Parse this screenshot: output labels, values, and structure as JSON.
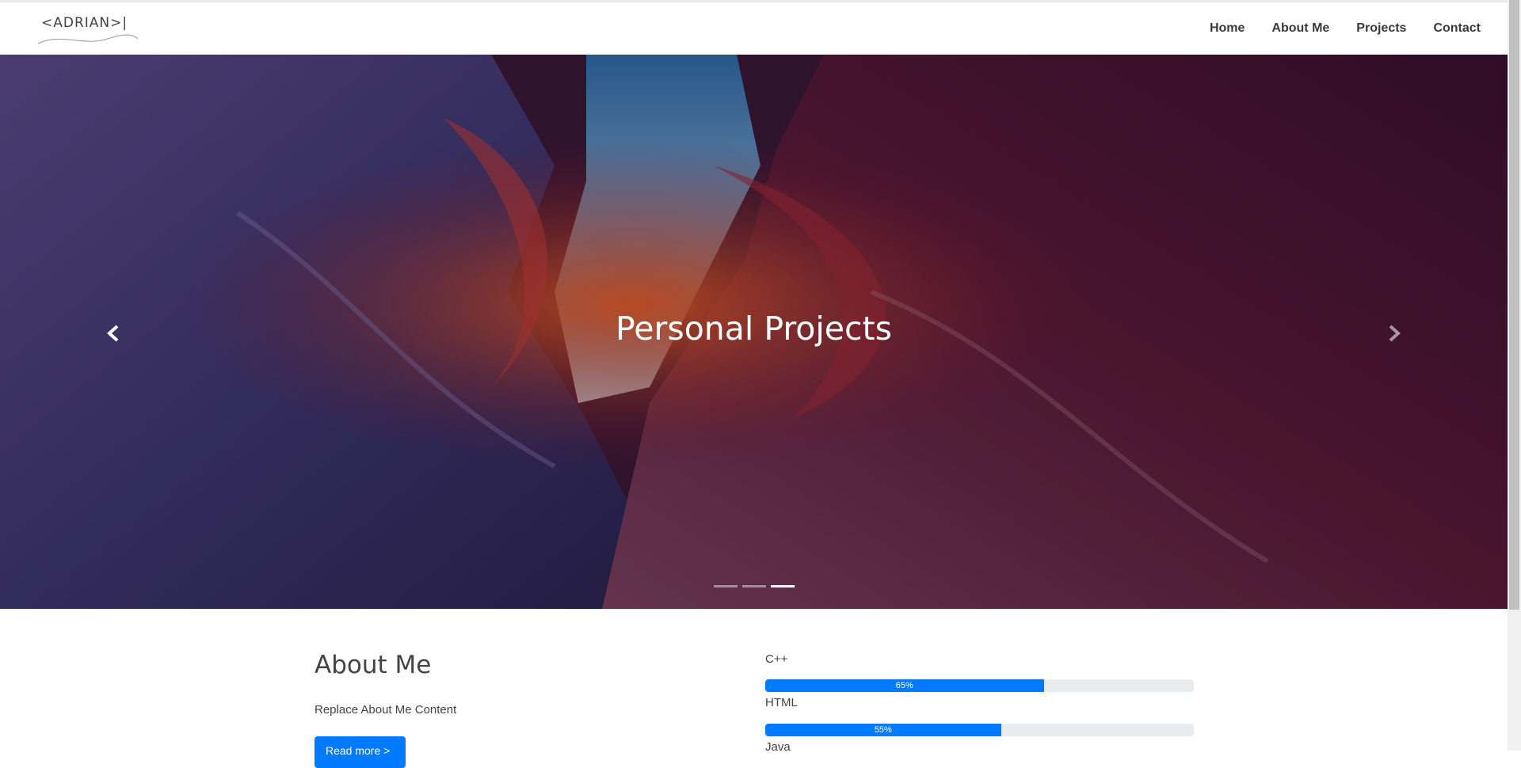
{
  "logo": {
    "text": "<ADRIAN>|"
  },
  "nav": {
    "items": [
      "Home",
      "About Me",
      "Projects",
      "Contact"
    ]
  },
  "hero": {
    "title": "Personal Projects",
    "slides_count": 3,
    "active_slide": 3,
    "prev_icon": "chevron-left-icon",
    "next_icon": "chevron-right-icon"
  },
  "about": {
    "title": "About Me",
    "text": "Replace About Me Content",
    "button_label": "Read more >"
  },
  "skills": [
    {
      "name": "C++",
      "percent": 65,
      "label": "65%"
    },
    {
      "name": "HTML",
      "percent": 55,
      "label": "55%"
    },
    {
      "name": "Java",
      "percent": null,
      "label": ""
    }
  ],
  "colors": {
    "accent": "#007bff",
    "bar_track": "#e9ecef"
  }
}
